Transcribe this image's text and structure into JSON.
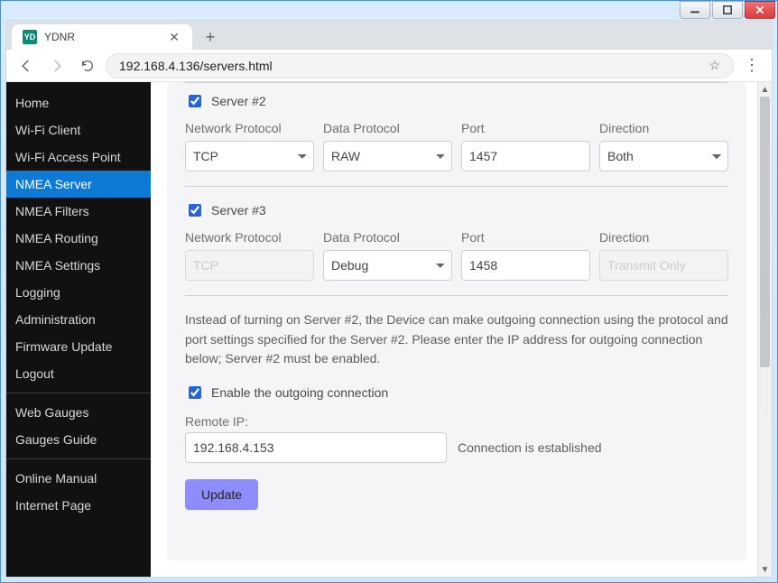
{
  "window": {
    "tab_title": "YDNR",
    "favicon_text": "YD",
    "url": "192.168.4.136/servers.html"
  },
  "sidebar": {
    "items": [
      {
        "label": "Home"
      },
      {
        "label": "Wi-Fi Client"
      },
      {
        "label": "Wi-Fi Access Point"
      },
      {
        "label": "NMEA Server"
      },
      {
        "label": "NMEA Filters"
      },
      {
        "label": "NMEA Routing"
      },
      {
        "label": "NMEA Settings"
      },
      {
        "label": "Logging"
      },
      {
        "label": "Administration"
      },
      {
        "label": "Firmware Update"
      },
      {
        "label": "Logout"
      }
    ],
    "group2": [
      {
        "label": "Web Gauges"
      },
      {
        "label": "Gauges Guide"
      }
    ],
    "group3": [
      {
        "label": "Online Manual"
      },
      {
        "label": "Internet Page"
      }
    ],
    "active_index": 3
  },
  "form": {
    "server2": {
      "checkbox_label": "Server #2",
      "np_label": "Network Protocol",
      "np_value": "TCP",
      "dp_label": "Data Protocol",
      "dp_value": "RAW",
      "port_label": "Port",
      "port_value": "1457",
      "dir_label": "Direction",
      "dir_value": "Both"
    },
    "server3": {
      "checkbox_label": "Server #3",
      "np_label": "Network Protocol",
      "np_value": "TCP",
      "dp_label": "Data Protocol",
      "dp_value": "Debug",
      "port_label": "Port",
      "port_value": "1458",
      "dir_label": "Direction",
      "dir_value": "Transmit Only"
    },
    "help_text": "Instead of turning on Server #2, the Device can make outgoing connection using the protocol and port settings specified for the Server #2. Please enter the IP address for outgoing connection below; Server #2 must be enabled.",
    "outgoing_label": "Enable the outgoing connection",
    "remote_ip_label": "Remote IP:",
    "remote_ip_value": "192.168.4.153",
    "connection_status": "Connection is established",
    "update_label": "Update"
  }
}
